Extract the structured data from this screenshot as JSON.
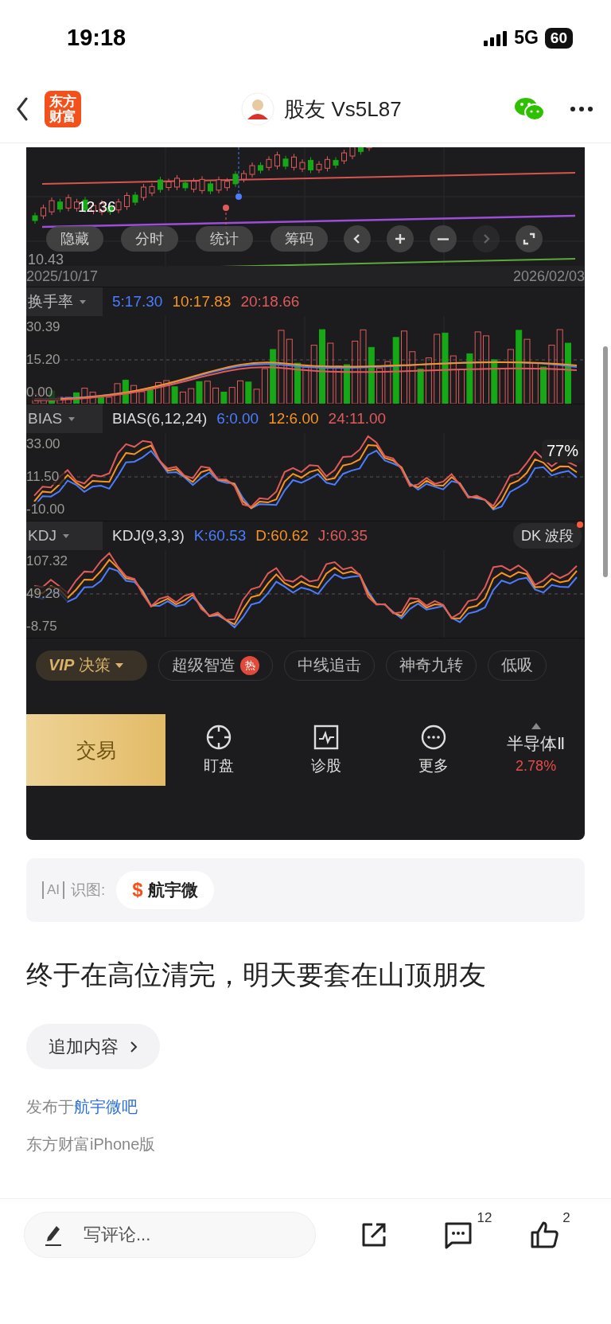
{
  "status_bar": {
    "time": "19:18",
    "network": "5G",
    "battery": "60"
  },
  "nav": {
    "logo": "东方财富",
    "title": "股友 Vs5L87"
  },
  "post_image": {
    "price_chart": {
      "price_label": "12.36",
      "low_label": "10.43",
      "start_date": "2025/10/17",
      "end_date": "2026/02/03",
      "buttons": [
        {
          "label": "隐藏"
        },
        {
          "label": "分时"
        },
        {
          "label": "统计"
        },
        {
          "label": "筹码"
        }
      ],
      "nav_buttons": [
        {
          "kind": "prev",
          "disabled": false
        },
        {
          "kind": "zoom_in",
          "disabled": false
        },
        {
          "kind": "zoom_out",
          "disabled": false
        },
        {
          "kind": "next",
          "disabled": true
        },
        {
          "kind": "fullscreen",
          "disabled": false
        }
      ]
    },
    "indicators": [
      {
        "kind": "bars",
        "name": "换手率",
        "values": [
          {
            "text": "5:17.30",
            "color": "#4a7dff"
          },
          {
            "text": "10:17.83",
            "color": "#f7931e"
          },
          {
            "text": "20:18.66",
            "color": "#e05a5a"
          }
        ],
        "yticks": [
          "30.39",
          "15.20",
          "0.00"
        ]
      },
      {
        "kind": "lines",
        "name": "BIAS",
        "formula": "BIAS(6,12,24)",
        "values": [
          {
            "text": "6:0.00",
            "color": "#4a7dff"
          },
          {
            "text": "12:6.00",
            "color": "#f7931e"
          },
          {
            "text": "24:11.00",
            "color": "#e05a5a"
          }
        ],
        "yticks": [
          "33.00",
          "11.50",
          "-10.00"
        ],
        "bubble": "77%"
      },
      {
        "kind": "lines",
        "name": "KDJ",
        "formula": "KDJ(9,3,3)",
        "values": [
          {
            "text": "K:60.53",
            "color": "#4a7dff"
          },
          {
            "text": "D:60.62",
            "color": "#f7931e"
          },
          {
            "text": "J:60.35",
            "color": "#e05a5a"
          }
        ],
        "yticks": [
          "107.32",
          "49.28",
          "-8.75"
        ],
        "tag": "DK 波段"
      }
    ],
    "strategy_chips": [
      {
        "kind": "vip",
        "emphasis": "VIP",
        "label": "决策"
      },
      {
        "kind": "plain",
        "label": "超级智造",
        "badge": "热"
      },
      {
        "kind": "plain",
        "label": "中线追击"
      },
      {
        "kind": "plain",
        "label": "神奇九转"
      },
      {
        "kind": "plain",
        "label": "低吸"
      }
    ],
    "toolbar": {
      "trade": "交易",
      "items": [
        {
          "kind": "watch",
          "label": "盯盘"
        },
        {
          "kind": "diagnose",
          "label": "诊股"
        },
        {
          "kind": "more",
          "label": "更多"
        }
      ],
      "sector": {
        "name": "半导体Ⅱ",
        "change": "2.78%"
      }
    }
  },
  "ai_recognize": {
    "icon_text": "AI",
    "label": "识图:",
    "stock": {
      "symbol": "$",
      "name": "航宇微"
    }
  },
  "post": {
    "text": "终于在高位清完，明天要套在山顶朋友",
    "append_button": "追加内容",
    "source_prefix": "发布于",
    "source_link": "航宇微吧",
    "client": "东方财富iPhone版"
  },
  "bottom_bar": {
    "comment_placeholder": "写评论...",
    "comment_count": "12",
    "like_count": "2"
  }
}
